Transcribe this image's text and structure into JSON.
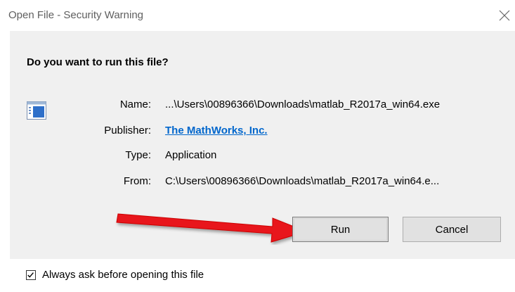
{
  "window": {
    "title": "Open File - Security Warning",
    "close_icon": "close-icon"
  },
  "dialog": {
    "question": "Do you want to run this file?",
    "file_icon": "executable-file-icon",
    "details": {
      "name_label": "Name:",
      "name_value": "...\\Users\\00896366\\Downloads\\matlab_R2017a_win64.exe",
      "publisher_label": "Publisher:",
      "publisher_value": "The MathWorks, Inc.",
      "type_label": "Type:",
      "type_value": "Application",
      "from_label": "From:",
      "from_value": "C:\\Users\\00896366\\Downloads\\matlab_R2017a_win64.e..."
    },
    "buttons": {
      "run": "Run",
      "cancel": "Cancel"
    },
    "annotation": "red-arrow-pointing-to-run",
    "checkbox": {
      "label": "Always ask before opening this file",
      "checked": true
    }
  },
  "colors": {
    "link": "#0066cc",
    "panel": "#f0f0f0",
    "button": "#e1e1e1",
    "arrow": "#e8141b"
  }
}
